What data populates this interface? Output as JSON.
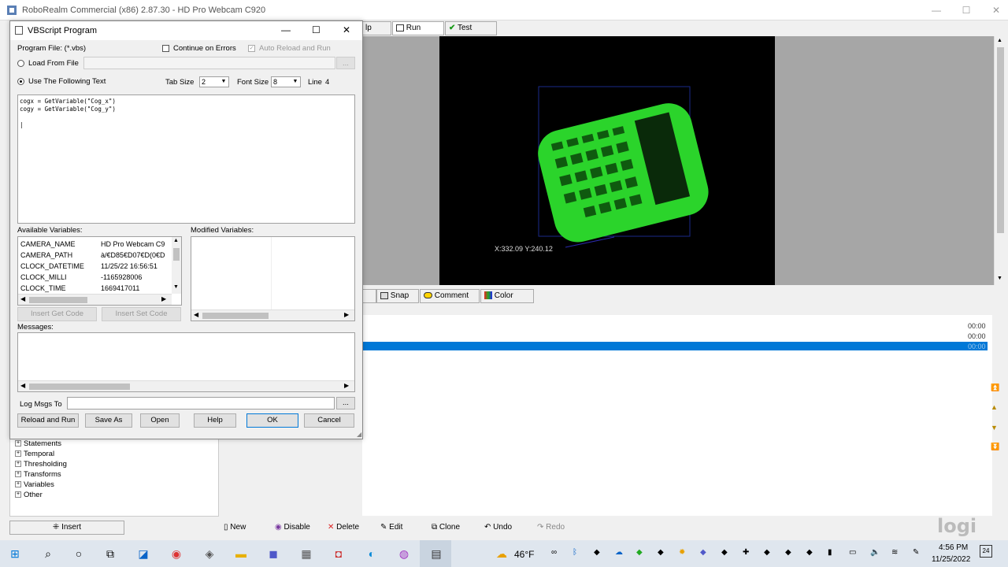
{
  "window": {
    "title": "RoboRealm Commercial (x86) 2.87.30 - HD Pro Webcam C920"
  },
  "toolbar_top": {
    "help_partial": "lp",
    "run": "Run",
    "test": "Test"
  },
  "video": {
    "coordinate_readout": "X:332.09 Y:240.12"
  },
  "toolbar_mid": {
    "snap": "Snap",
    "comment": "Comment",
    "color": "Color"
  },
  "log": {
    "times": [
      "00:00",
      "00:00",
      "00:00"
    ]
  },
  "dialog": {
    "title": "VBScript Program",
    "program_file_label": "Program File: (*.vbs)",
    "continue_on_errors": "Continue on Errors",
    "auto_reload": "Auto Reload and Run",
    "load_from_file": "Load From File",
    "browse": "...",
    "use_following_text": "Use The Following Text",
    "tab_size_label": "Tab Size",
    "tab_size_value": "2",
    "font_size_label": "Font Size",
    "font_size_value": "8",
    "line_label": "Line",
    "line_value": "4",
    "code": "cogx = GetVariable(\"Cog_x\")\ncogy = GetVariable(\"Cog_y\")\n\n|",
    "available_variables_label": "Available Variables:",
    "modified_variables_label": "Modified Variables:",
    "variables": [
      {
        "name": "CAMERA_NAME",
        "value": "HD Pro Webcam C9"
      },
      {
        "name": "CAMERA_PATH",
        "value": "à/€D85€D07€D(0€D"
      },
      {
        "name": "CLOCK_DATETIME",
        "value": "11/25/22 16:56:51"
      },
      {
        "name": "CLOCK_MILLI",
        "value": "-1165928006"
      },
      {
        "name": "CLOCK_TIME",
        "value": "1669417011"
      }
    ],
    "insert_get_code": "Insert Get Code",
    "insert_set_code": "Insert Set Code",
    "messages_label": "Messages:",
    "log_msgs_label": "Log Msgs To",
    "log_browse": "...",
    "buttons": {
      "reload_and_run": "Reload and Run",
      "save_as": "Save As",
      "open": "Open",
      "help": "Help",
      "ok": "OK",
      "cancel": "Cancel"
    }
  },
  "tree": [
    "Statements",
    "Temporal",
    "Thresholding",
    "Transforms",
    "Variables",
    "Other"
  ],
  "bottom_bar": {
    "insert": "Insert",
    "new": "New",
    "disable": "Disable",
    "delete": "Delete",
    "edit": "Edit",
    "clone": "Clone",
    "undo": "Undo",
    "redo": "Redo"
  },
  "watermark": "logi",
  "taskbar": {
    "weather": "46°F",
    "time": "4:56 PM",
    "date": "11/25/2022",
    "notifications": "24"
  },
  "colors": {
    "accent": "#0078d7",
    "green_check": "#1a9a1a"
  }
}
